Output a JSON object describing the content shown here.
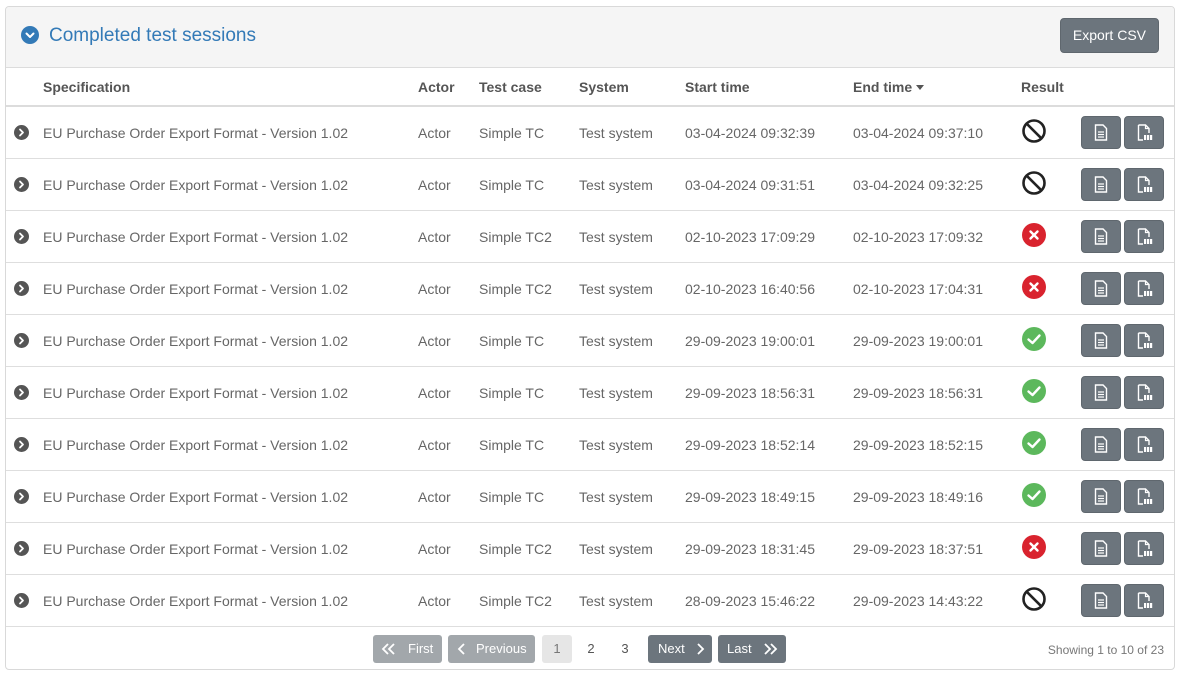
{
  "panel": {
    "title": "Completed test sessions",
    "export_label": "Export CSV"
  },
  "table": {
    "columns": {
      "specification": "Specification",
      "actor": "Actor",
      "test_case": "Test case",
      "system": "System",
      "start_time": "Start time",
      "end_time": "End time",
      "result": "Result"
    },
    "sorted_column": "end_time",
    "sort_direction": "descending",
    "rows": [
      {
        "specification": "EU Purchase Order Export Format - Version 1.02",
        "actor": "Actor",
        "test_case": "Simple TC",
        "system": "Test system",
        "start_time": "03-04-2024 09:32:39",
        "end_time": "03-04-2024 09:37:10",
        "result": "undefined"
      },
      {
        "specification": "EU Purchase Order Export Format - Version 1.02",
        "actor": "Actor",
        "test_case": "Simple TC",
        "system": "Test system",
        "start_time": "03-04-2024 09:31:51",
        "end_time": "03-04-2024 09:32:25",
        "result": "undefined"
      },
      {
        "specification": "EU Purchase Order Export Format - Version 1.02",
        "actor": "Actor",
        "test_case": "Simple TC2",
        "system": "Test system",
        "start_time": "02-10-2023 17:09:29",
        "end_time": "02-10-2023 17:09:32",
        "result": "failure"
      },
      {
        "specification": "EU Purchase Order Export Format - Version 1.02",
        "actor": "Actor",
        "test_case": "Simple TC2",
        "system": "Test system",
        "start_time": "02-10-2023 16:40:56",
        "end_time": "02-10-2023 17:04:31",
        "result": "failure"
      },
      {
        "specification": "EU Purchase Order Export Format - Version 1.02",
        "actor": "Actor",
        "test_case": "Simple TC",
        "system": "Test system",
        "start_time": "29-09-2023 19:00:01",
        "end_time": "29-09-2023 19:00:01",
        "result": "success"
      },
      {
        "specification": "EU Purchase Order Export Format - Version 1.02",
        "actor": "Actor",
        "test_case": "Simple TC",
        "system": "Test system",
        "start_time": "29-09-2023 18:56:31",
        "end_time": "29-09-2023 18:56:31",
        "result": "success"
      },
      {
        "specification": "EU Purchase Order Export Format - Version 1.02",
        "actor": "Actor",
        "test_case": "Simple TC",
        "system": "Test system",
        "start_time": "29-09-2023 18:52:14",
        "end_time": "29-09-2023 18:52:15",
        "result": "success"
      },
      {
        "specification": "EU Purchase Order Export Format - Version 1.02",
        "actor": "Actor",
        "test_case": "Simple TC",
        "system": "Test system",
        "start_time": "29-09-2023 18:49:15",
        "end_time": "29-09-2023 18:49:16",
        "result": "success"
      },
      {
        "specification": "EU Purchase Order Export Format - Version 1.02",
        "actor": "Actor",
        "test_case": "Simple TC2",
        "system": "Test system",
        "start_time": "29-09-2023 18:31:45",
        "end_time": "29-09-2023 18:37:51",
        "result": "failure"
      },
      {
        "specification": "EU Purchase Order Export Format - Version 1.02",
        "actor": "Actor",
        "test_case": "Simple TC2",
        "system": "Test system",
        "start_time": "28-09-2023 15:46:22",
        "end_time": "29-09-2023 14:43:22",
        "result": "undefined"
      }
    ]
  },
  "pagination": {
    "first_label": "First",
    "previous_label": "Previous",
    "next_label": "Next",
    "last_label": "Last",
    "pages": [
      "1",
      "2",
      "3"
    ],
    "current_page": "1",
    "showing_text": "Showing 1 to 10 of 23"
  },
  "colors": {
    "accent": "#337ab7",
    "button": "#6c757d",
    "success": "#5cb85c",
    "failure": "#d9232e",
    "undefined": "#222222"
  },
  "icons": {
    "collapse": "chevron-down-circle-icon",
    "expand_row": "chevron-right-circle-icon",
    "report": "file-text-icon",
    "pdf": "file-pdf-icon",
    "success": "check-circle-icon",
    "failure": "x-circle-icon",
    "undefined": "ban-icon"
  }
}
